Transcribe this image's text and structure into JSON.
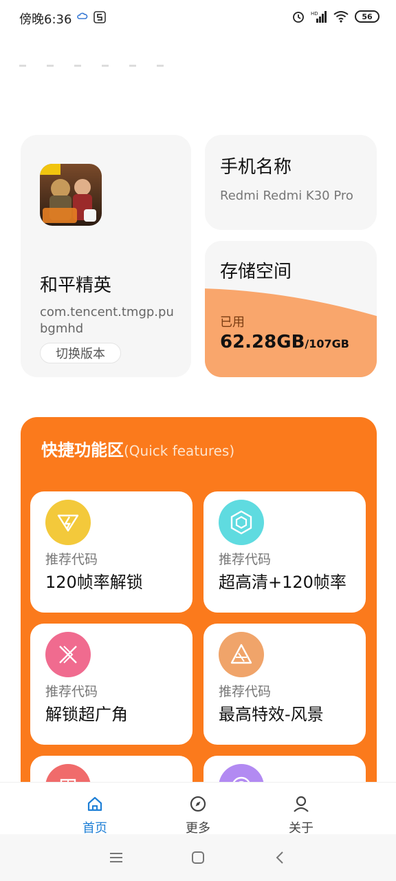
{
  "status_bar": {
    "time": "傍晚6:36",
    "battery": "56"
  },
  "game": {
    "name": "和平精英",
    "package": "com.tencent.tmgp.pubgmhd",
    "switch_label": "切换版本"
  },
  "phone": {
    "title": "手机名称",
    "model": "Redmi Redmi K30 Pro"
  },
  "storage": {
    "title": "存储空间",
    "used_label": "已用",
    "used_value": "62.28GB",
    "total": "/107GB",
    "used_fraction": 0.58
  },
  "quick": {
    "title": "快捷功能区",
    "subtitle": "(Quick features)",
    "items": [
      {
        "sub": "推荐代码",
        "name": "120帧率解锁",
        "icon": "lightning-icon",
        "color": "#f3c93b"
      },
      {
        "sub": "推荐代码",
        "name": "超高清+120帧率",
        "icon": "hexagon-icon",
        "color": "#5fdbe0"
      },
      {
        "sub": "推荐代码",
        "name": "解锁超广角",
        "icon": "wide-angle-icon",
        "color": "#f06b8f"
      },
      {
        "sub": "推荐代码",
        "name": "最高特效-风景",
        "icon": "landscape-icon",
        "color": "#f0a46a"
      },
      {
        "icon": "grid-icon",
        "color": "#f06b6b"
      },
      {
        "icon": "circle-icon",
        "color": "#b28af2"
      }
    ]
  },
  "nav": {
    "items": [
      {
        "label": "首页"
      },
      {
        "label": "更多"
      },
      {
        "label": "关于"
      }
    ],
    "active_color": "#1e7fd6"
  }
}
